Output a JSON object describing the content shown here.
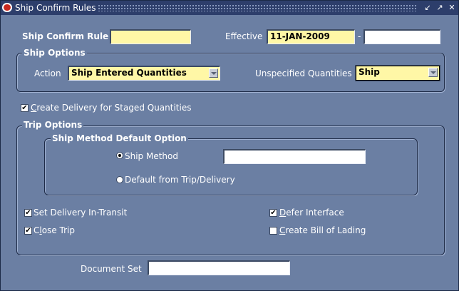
{
  "window": {
    "title": "Ship Confirm Rules"
  },
  "form": {
    "rule_label": "Ship Confirm Rule",
    "rule_value": "",
    "effective_label": "Effective",
    "effective_from": "11-JAN-2009",
    "dash": "-",
    "effective_to": ""
  },
  "ship_options": {
    "title": "Ship Options",
    "action_label": "Action",
    "action_value": "Ship Entered Quantities",
    "unspecified_label": "Unspecified Quantities",
    "unspecified_value": "Ship"
  },
  "create_delivery": {
    "checked": true,
    "label_first": "C",
    "label_rest": "reate Delivery for Staged Quantities"
  },
  "trip_options": {
    "title": "Trip Options",
    "ship_method_group": {
      "title": "Ship Method Default Option",
      "ship_method_label": "Ship Method",
      "ship_method_value": "",
      "default_label": "Default from Trip/Delivery"
    },
    "set_delivery_in_transit": {
      "checked": true,
      "label": "Set Delivery In-Transit"
    },
    "close_trip": {
      "checked": true,
      "label_pre": "C",
      "label_u": "l",
      "label_post": "ose Trip"
    },
    "defer_interface": {
      "checked": true,
      "label_first": "D",
      "label_rest": "efer Interface"
    },
    "create_bol": {
      "checked": false,
      "label_first": "C",
      "label_rest": "reate Bill of Lading"
    }
  },
  "document_set": {
    "label": "Document Set",
    "value": ""
  }
}
